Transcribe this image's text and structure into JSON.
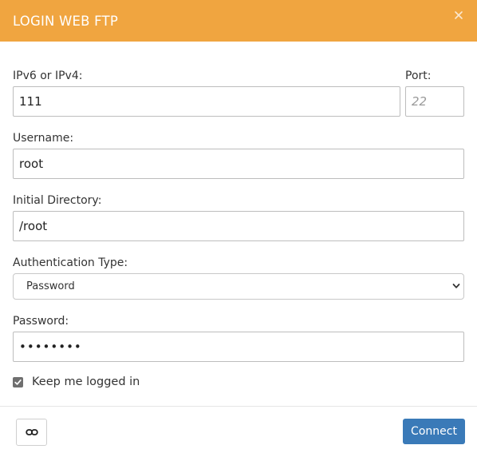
{
  "dialog": {
    "title": "LOGIN WEB FTP",
    "close_icon": "close-icon",
    "header_color": "#f0a540"
  },
  "form": {
    "host": {
      "label": "IPv6 or IPv4:",
      "value": "111"
    },
    "port": {
      "label": "Port:",
      "value": "",
      "placeholder": "22"
    },
    "username": {
      "label": "Username:",
      "value": "root"
    },
    "directory": {
      "label": "Initial Directory:",
      "value": "/root"
    },
    "auth_type": {
      "label": "Authentication Type:",
      "selected": "Password"
    },
    "password": {
      "label": "Password:",
      "value": "••••••••"
    },
    "keep_logged_in": {
      "label": "Keep me logged in",
      "checked": true
    }
  },
  "footer": {
    "link_icon": "link-icon",
    "connect_label": "Connect",
    "connect_color": "#3a7ab8"
  }
}
